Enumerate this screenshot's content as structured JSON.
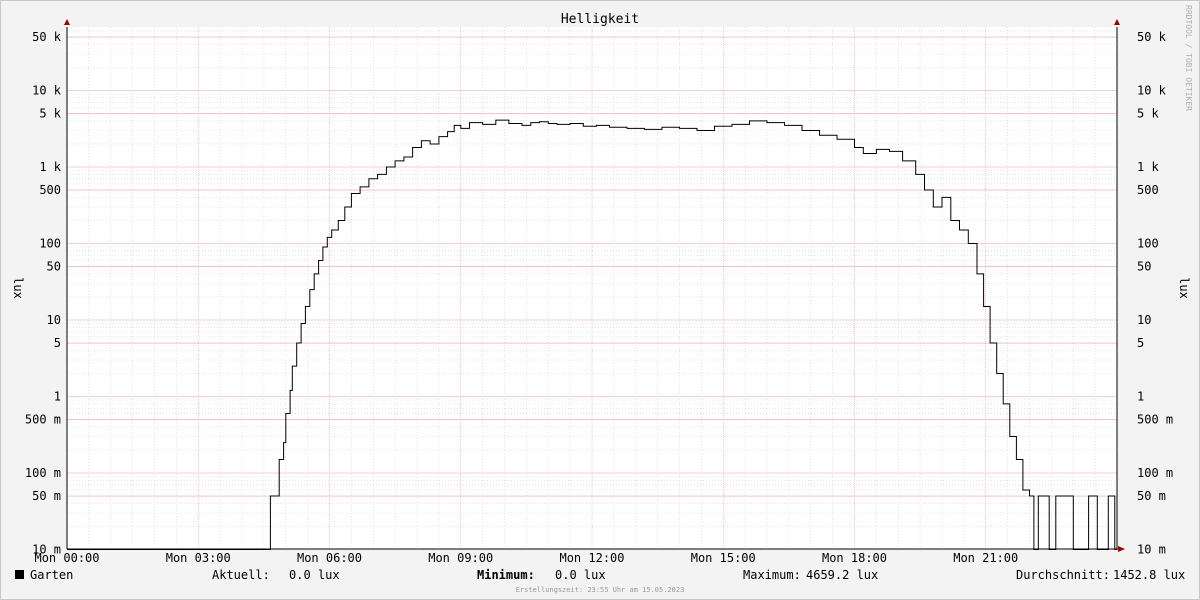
{
  "chart_data": {
    "type": "line",
    "title": "Helligkeit",
    "ylabel": "lux",
    "y_scale": "log",
    "ylim": [
      0.01,
      80000
    ],
    "xlim_hours": [
      0,
      24
    ],
    "grid": true,
    "watermark": "RRDTOOL / TOBI OETIKER",
    "x_ticks": [
      {
        "h": 0,
        "label": "Mon 00:00"
      },
      {
        "h": 3,
        "label": "Mon 03:00"
      },
      {
        "h": 6,
        "label": "Mon 06:00"
      },
      {
        "h": 9,
        "label": "Mon 09:00"
      },
      {
        "h": 12,
        "label": "Mon 12:00"
      },
      {
        "h": 15,
        "label": "Mon 15:00"
      },
      {
        "h": 18,
        "label": "Mon 18:00"
      },
      {
        "h": 21,
        "label": "Mon 21:00"
      }
    ],
    "y_ticks": [
      {
        "v": 50000,
        "label": "50 k"
      },
      {
        "v": 10000,
        "label": "10 k"
      },
      {
        "v": 5000,
        "label": "5 k"
      },
      {
        "v": 1000,
        "label": "1 k"
      },
      {
        "v": 500,
        "label": "500"
      },
      {
        "v": 100,
        "label": "100"
      },
      {
        "v": 50,
        "label": "50"
      },
      {
        "v": 10,
        "label": "10"
      },
      {
        "v": 5,
        "label": "5"
      },
      {
        "v": 1,
        "label": "1"
      },
      {
        "v": 0.5,
        "label": "500 m"
      },
      {
        "v": 0.1,
        "label": "100 m"
      },
      {
        "v": 0.05,
        "label": "50 m"
      },
      {
        "v": 0.01,
        "label": "10 m"
      }
    ],
    "series": [
      {
        "name": "Garten",
        "color": "#000000",
        "x_hours": [
          0,
          4.6,
          4.65,
          4.8,
          4.85,
          4.95,
          5.0,
          5.1,
          5.15,
          5.25,
          5.35,
          5.45,
          5.55,
          5.65,
          5.75,
          5.85,
          5.95,
          6.05,
          6.2,
          6.35,
          6.5,
          6.7,
          6.9,
          7.1,
          7.3,
          7.5,
          7.7,
          7.9,
          8.1,
          8.3,
          8.5,
          8.7,
          8.85,
          9.0,
          9.2,
          9.5,
          9.8,
          10.1,
          10.4,
          10.6,
          10.8,
          11.0,
          11.2,
          11.5,
          11.8,
          12.1,
          12.4,
          12.8,
          13.2,
          13.6,
          14.0,
          14.4,
          14.8,
          15.2,
          15.6,
          16.0,
          16.4,
          16.8,
          17.2,
          17.6,
          18.0,
          18.2,
          18.5,
          18.8,
          19.1,
          19.4,
          19.6,
          19.8,
          20.0,
          20.2,
          20.4,
          20.6,
          20.8,
          20.95,
          21.1,
          21.25,
          21.4,
          21.55,
          21.7,
          21.85,
          22.0,
          22.1,
          22.2,
          22.3,
          22.45,
          22.55,
          22.6,
          22.7,
          22.75,
          22.95,
          23.0,
          23.3,
          23.35,
          23.5,
          23.55,
          23.75,
          23.8,
          23.9,
          23.95,
          24.0
        ],
        "values": [
          0.01,
          0.01,
          0.05,
          0.05,
          0.15,
          0.25,
          0.6,
          1.2,
          2.5,
          5,
          9,
          15,
          25,
          40,
          60,
          90,
          120,
          150,
          200,
          300,
          450,
          550,
          700,
          800,
          1000,
          1200,
          1350,
          1800,
          2200,
          2000,
          2500,
          2900,
          3500,
          3200,
          3800,
          3600,
          4100,
          3700,
          3500,
          3800,
          3900,
          3700,
          3600,
          3700,
          3400,
          3500,
          3300,
          3200,
          3100,
          3300,
          3200,
          3000,
          3400,
          3600,
          4000,
          3800,
          3500,
          3000,
          2600,
          2300,
          1800,
          1500,
          1700,
          1600,
          1200,
          800,
          500,
          300,
          400,
          200,
          150,
          100,
          40,
          15,
          5,
          2,
          0.8,
          0.3,
          0.15,
          0.06,
          0.05,
          0.01,
          0.05,
          0.05,
          0.01,
          0.01,
          0.05,
          0.05,
          0.05,
          0.05,
          0.01,
          0.01,
          0.05,
          0.05,
          0.01,
          0.01,
          0.05,
          0.05,
          0.01,
          0.01
        ]
      }
    ]
  },
  "legend": {
    "series_name": "Garten",
    "series_color": "#000000",
    "current_label": "Aktuell:",
    "current_value": "0.0 lux",
    "min_label": "Minimum:",
    "min_value": "0.0 lux",
    "max_label": "Maximum:",
    "max_value": "4659.2 lux",
    "avg_label": "Durchschnitt:",
    "avg_value": "1452.8 lux"
  },
  "footer": {
    "created": "Erstellungszeit: 23:55 Uhr am 15.05.2023"
  },
  "colors": {
    "background": "#f3f3f3",
    "canvas": "#ffffff",
    "major_grid": "#e8a0a8",
    "minor_grid": "#d0d0d0",
    "axis_arrow": "#a00000"
  }
}
